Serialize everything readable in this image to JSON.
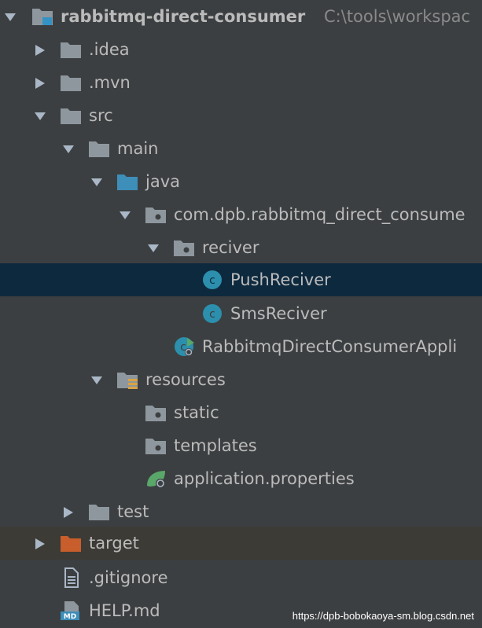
{
  "project": {
    "name": "rabbitmq-direct-consumer",
    "path": "C:\\tools\\workspac"
  },
  "tree": {
    "idea": ".idea",
    "mvn": ".mvn",
    "src": "src",
    "main": "main",
    "java": "java",
    "package": "com.dpb.rabbitmq_direct_consume",
    "reciver": "reciver",
    "push_reciver": "PushReciver",
    "sms_reciver": "SmsReciver",
    "application_class": "RabbitmqDirectConsumerAppli",
    "resources": "resources",
    "static": "static",
    "templates": "templates",
    "application_properties": "application.properties",
    "test": "test",
    "target": "target",
    "gitignore": ".gitignore",
    "help": "HELP.md"
  },
  "icons": {
    "folder": "folder-icon",
    "source_folder": "source-folder-icon",
    "package": "package-icon",
    "class": "class-icon",
    "spring_boot": "spring-boot-app-icon",
    "resources_folder": "resources-folder-icon",
    "properties": "spring-properties-icon",
    "excluded_folder": "excluded-folder-icon",
    "file": "text-file-icon",
    "markdown": "markdown-file-icon"
  },
  "colors": {
    "background": "#3c3f41",
    "selected_row": "#0d293e",
    "excluded_row": "#3d3b36",
    "folder": "#8e979e",
    "source_folder": "#3d8eb9",
    "excluded_folder": "#c75e2c",
    "class": "#2c8fad",
    "text": "#bbbbbb"
  },
  "watermark": "https://dpb-bobokaoya-sm.blog.csdn.net"
}
